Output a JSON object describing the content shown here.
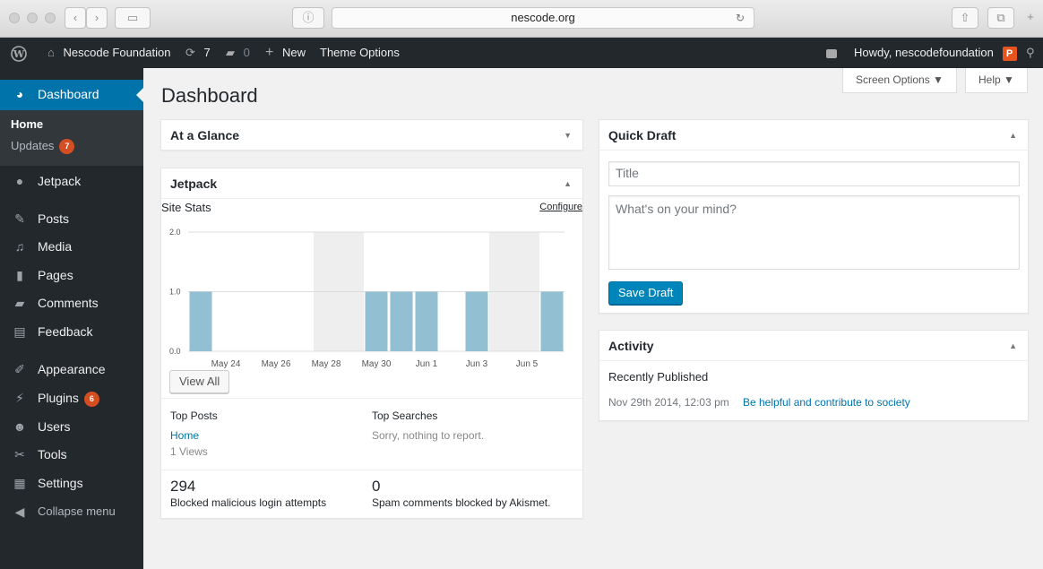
{
  "browser": {
    "url": "nescode.org"
  },
  "adminbar": {
    "site_name": "Nescode Foundation",
    "updates_count": "7",
    "comments_count": "0",
    "new_label": "New",
    "theme_options": "Theme Options",
    "howdy": "Howdy, nescodefoundation",
    "avatar_letter": "P"
  },
  "sidebar": {
    "dashboard": "Dashboard",
    "sub_home": "Home",
    "sub_updates": "Updates",
    "sub_updates_badge": "7",
    "items": [
      {
        "label": "Jetpack",
        "icon": "jetpack-icon"
      },
      {
        "label": "Posts",
        "icon": "pin-icon"
      },
      {
        "label": "Media",
        "icon": "media-icon"
      },
      {
        "label": "Pages",
        "icon": "pages-icon"
      },
      {
        "label": "Comments",
        "icon": "comment-icon"
      },
      {
        "label": "Feedback",
        "icon": "feedback-icon"
      },
      {
        "label": "Appearance",
        "icon": "brush-icon"
      },
      {
        "label": "Plugins",
        "icon": "plugin-icon",
        "badge": "6"
      },
      {
        "label": "Users",
        "icon": "user-icon"
      },
      {
        "label": "Tools",
        "icon": "wrench-icon"
      },
      {
        "label": "Settings",
        "icon": "settings-icon"
      },
      {
        "label": "Collapse menu",
        "icon": "collapse-icon"
      }
    ]
  },
  "header": {
    "title": "Dashboard",
    "screen_options": "Screen Options ▼",
    "help": "Help ▼"
  },
  "at_a_glance": {
    "title": "At a Glance"
  },
  "jetpack": {
    "title": "Jetpack",
    "site_stats": "Site Stats",
    "configure": "Configure",
    "view_all": "View All",
    "top_posts_label": "Top Posts",
    "top_post_link": "Home",
    "top_post_views": "1 Views",
    "top_searches_label": "Top Searches",
    "top_searches_empty": "Sorry, nothing to report.",
    "blocked_count": "294",
    "blocked_label": "Blocked malicious login attempts",
    "spam_count": "0",
    "spam_label": "Spam comments blocked by Akismet."
  },
  "quick_draft": {
    "title": "Quick Draft",
    "title_placeholder": "Title",
    "content_placeholder": "What's on your mind?",
    "save_label": "Save Draft"
  },
  "activity": {
    "title": "Activity",
    "recently_published": "Recently Published",
    "date": "Nov 29th 2014, 12:03 pm",
    "post_link": "Be helpful and contribute to society"
  },
  "chart_data": {
    "type": "bar",
    "categories": [
      "May 23",
      "May 24",
      "May 25",
      "May 26",
      "May 27",
      "May 28",
      "May 29",
      "May 30",
      "May 31",
      "Jun 1",
      "Jun 2",
      "Jun 3",
      "Jun 4",
      "Jun 5",
      "Jun 6"
    ],
    "tick_labels": [
      "May 24",
      "May 26",
      "May 28",
      "May 30",
      "Jun 1",
      "Jun 3",
      "Jun 5"
    ],
    "values": [
      1,
      0,
      0,
      0,
      0,
      0,
      0,
      1,
      1,
      1,
      0,
      1,
      0,
      0,
      1
    ],
    "weekend_columns": [
      5,
      6,
      12,
      13
    ],
    "ylim": [
      0,
      2
    ],
    "yticks": [
      "0.0",
      "1.0",
      "2.0"
    ],
    "bar_color": "#92bfd2",
    "weekend_color": "#eeeeee",
    "grid": true
  }
}
